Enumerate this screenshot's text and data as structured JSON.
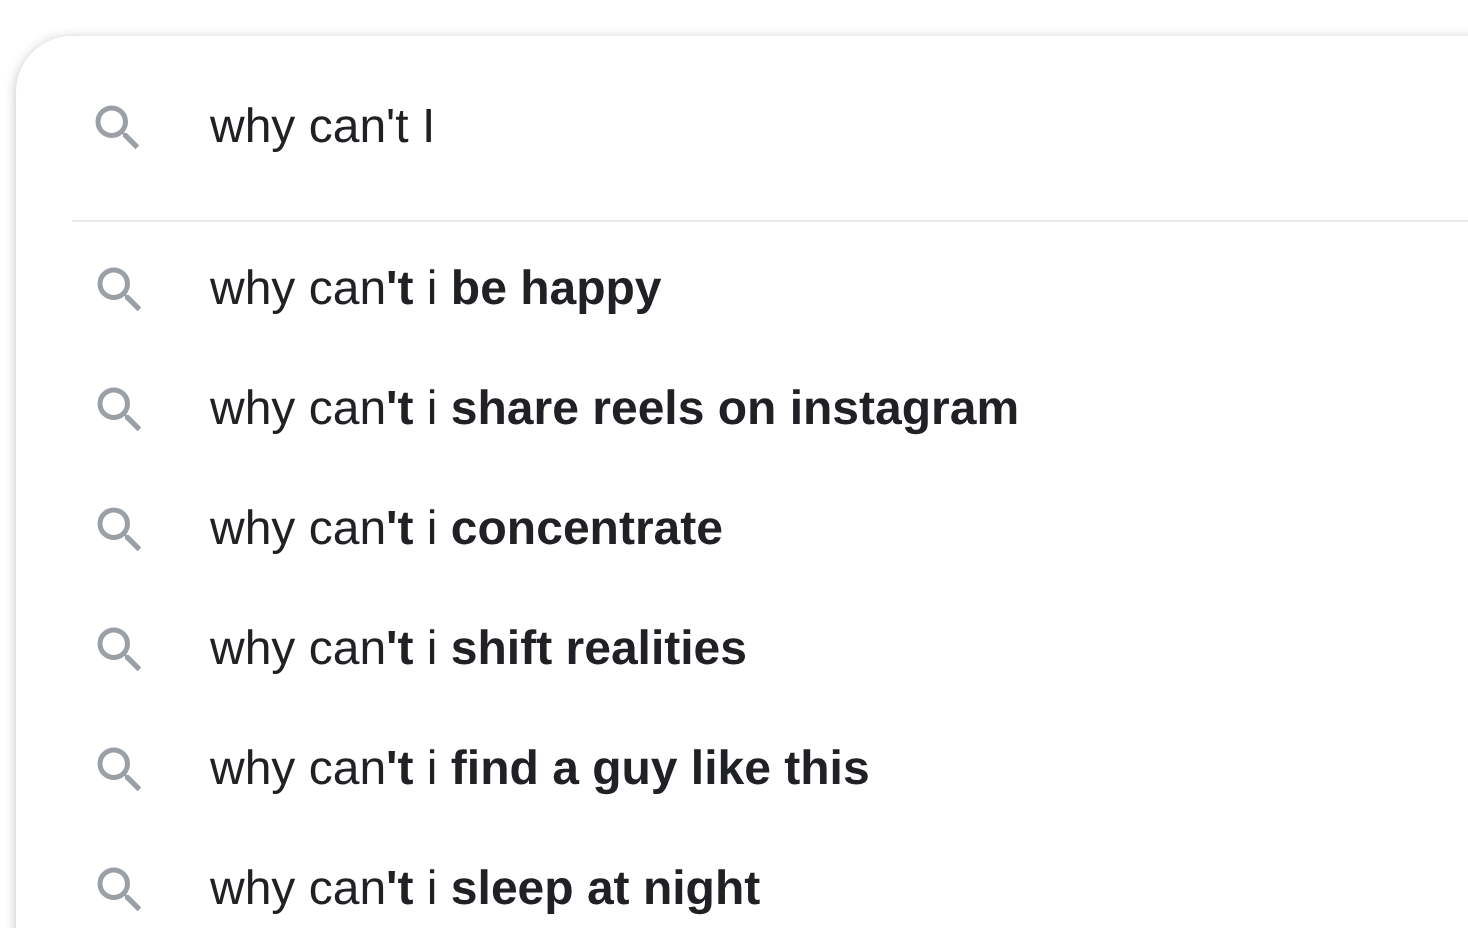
{
  "search": {
    "value": "why can't I"
  },
  "suggestions": [
    {
      "text": "why can**'t** i **be happy**"
    },
    {
      "text": "why can**'t** i **share reels on instagram**"
    },
    {
      "text": "why can**'t** i **concentrate**"
    },
    {
      "text": "why can**'t** i **shift realities**"
    },
    {
      "text": "why can**'t** i **find a guy like this**"
    },
    {
      "text": "why can**'t** i **sleep at night**"
    }
  ]
}
